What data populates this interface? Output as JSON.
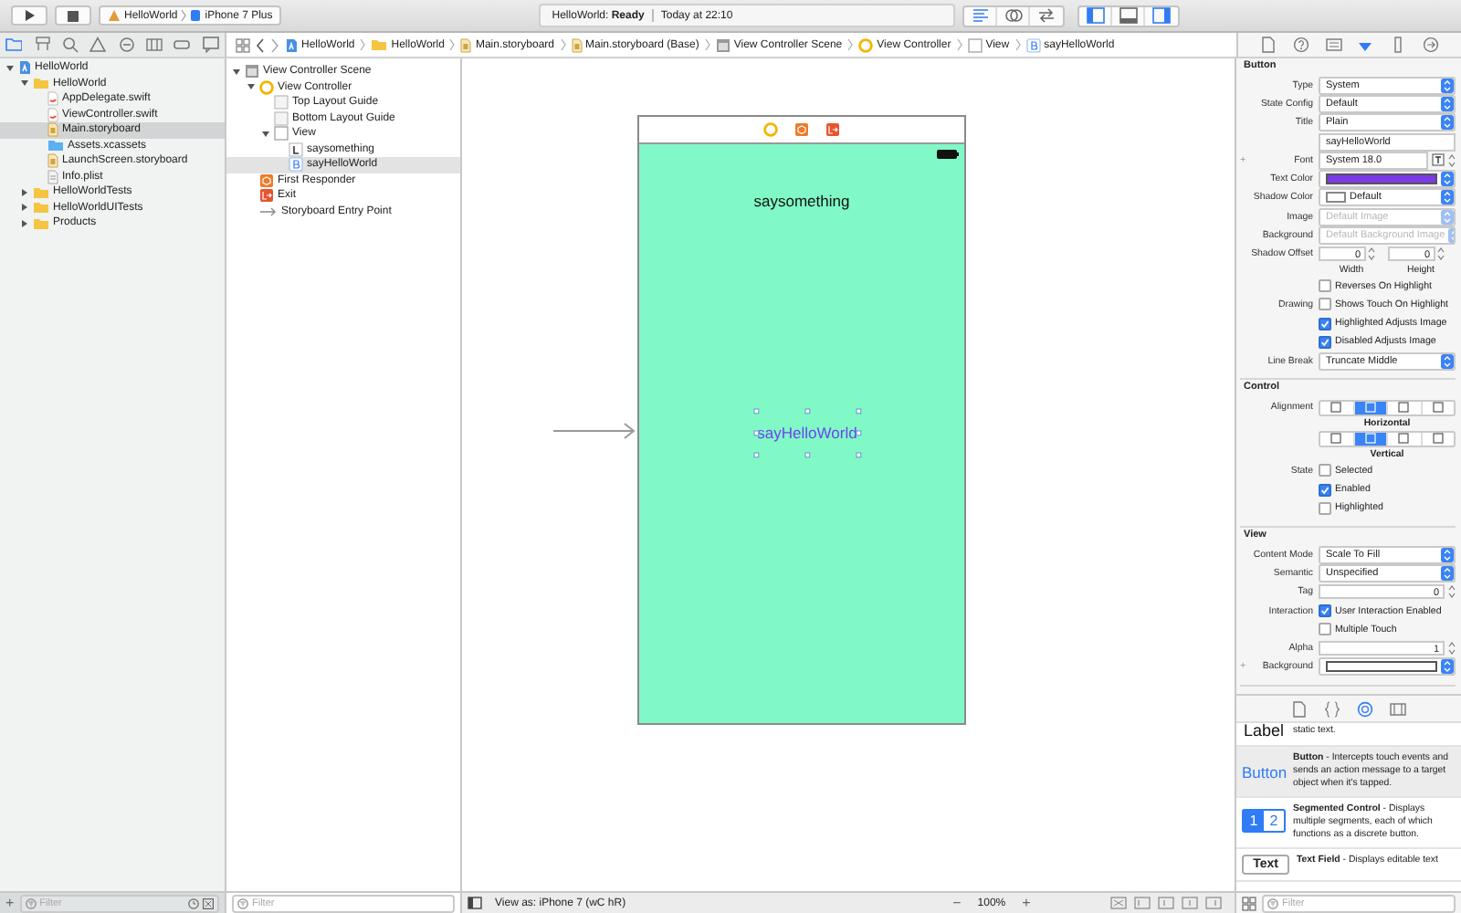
{
  "toolbar": {
    "scheme": {
      "project": "HelloWorld",
      "device": "iPhone 7 Plus"
    },
    "status": {
      "message": "HelloWorld: **Ready**",
      "time": "Today at 22:10"
    },
    "editor_modes": [
      {
        "selected": true
      },
      {
        "selected": false
      },
      {
        "selected": false
      }
    ],
    "panels": [
      {
        "on": true
      },
      {
        "on": false
      },
      {
        "on": true
      }
    ]
  },
  "navigator": {
    "tabs": [
      {
        "selected": true
      },
      {
        "selected": false
      },
      {
        "selected": false
      },
      {
        "selected": false
      },
      {
        "selected": false
      },
      {
        "selected": false
      },
      {
        "selected": false
      },
      {
        "selected": false
      }
    ],
    "items": [
      {
        "kind": "project",
        "label": "HelloWorld",
        "expanded": true,
        "selected": false,
        "children": [
          {
            "kind": "folder",
            "label": "HelloWorld",
            "expanded": true,
            "selected": false,
            "children": [
              {
                "kind": "swift",
                "label": "AppDelegate.swift",
                "selected": false
              },
              {
                "kind": "swift",
                "label": "ViewController.swift",
                "selected": false
              },
              {
                "kind": "storyboard",
                "label": "Main.storyboard",
                "selected": true
              },
              {
                "kind": "assets",
                "label": "Assets.xcassets",
                "selected": false
              },
              {
                "kind": "storyboard",
                "label": "LaunchScreen.storyboard",
                "selected": false
              },
              {
                "kind": "plist",
                "label": "Info.plist",
                "selected": false
              }
            ]
          },
          {
            "kind": "folder",
            "label": "HelloWorldTests",
            "expanded": false,
            "selected": false
          },
          {
            "kind": "folder",
            "label": "HelloWorldUITests",
            "expanded": false,
            "selected": false
          },
          {
            "kind": "folder",
            "label": "Products",
            "expanded": false,
            "selected": false
          }
        ]
      }
    ],
    "add": "+",
    "filter": {
      "placeholder": "Filter"
    }
  },
  "breadcrumb": [
    {
      "kind": "project",
      "label": "HelloWorld"
    },
    {
      "kind": "folder",
      "label": "HelloWorld"
    },
    {
      "kind": "storyboard",
      "label": "Main.storyboard"
    },
    {
      "kind": "storyboard",
      "label": "Main.storyboard (Base)"
    },
    {
      "kind": "scene",
      "label": "View Controller Scene"
    },
    {
      "kind": "viewcontroller",
      "label": "View Controller"
    },
    {
      "kind": "view",
      "label": "View"
    },
    {
      "kind": "button",
      "label": "sayHelloWorld"
    }
  ],
  "outline": {
    "items": [
      {
        "kind": "scene",
        "label": "View Controller Scene",
        "expanded": true,
        "selected": false,
        "children": [
          {
            "kind": "viewcontroller",
            "label": "View Controller",
            "expanded": true,
            "selected": false,
            "children": [
              {
                "kind": "guide",
                "label": "Top Layout Guide",
                "selected": false
              },
              {
                "kind": "guide",
                "label": "Bottom Layout Guide",
                "selected": false
              },
              {
                "kind": "view",
                "label": "View",
                "expanded": true,
                "selected": false,
                "children": [
                  {
                    "kind": "label",
                    "label": "saysomething",
                    "selected": false
                  },
                  {
                    "kind": "button",
                    "label": "sayHelloWorld",
                    "selected": true
                  }
                ]
              }
            ]
          },
          {
            "kind": "responder",
            "label": "First Responder",
            "selected": false
          },
          {
            "kind": "exit",
            "label": "Exit",
            "selected": false
          },
          {
            "kind": "entry",
            "label": "Storyboard Entry Point",
            "selected": false
          }
        ]
      }
    ],
    "filter": {
      "placeholder": "Filter"
    }
  },
  "canvas": {
    "scene": {
      "label": "saysomething",
      "button": "sayHelloWorld",
      "button_selected": true
    },
    "view_as": "View as: iPhone 7 (wC hR)",
    "zoom_out": "−",
    "zoom": "100%",
    "zoom_in": "+"
  },
  "inspector": {
    "tabs": [
      {
        "selected": false
      },
      {
        "selected": false
      },
      {
        "selected": false
      },
      {
        "selected": true
      },
      {
        "selected": false
      },
      {
        "selected": false
      }
    ],
    "sections": [
      {
        "title": "Button",
        "rows": [
          {
            "kind": "select",
            "label": "Type",
            "value": "System"
          },
          {
            "kind": "select",
            "label": "State Config",
            "value": "Default"
          },
          {
            "kind": "select",
            "label": "Title",
            "value": "Plain"
          },
          {
            "kind": "text",
            "value": "sayHelloWorld"
          },
          {
            "kind": "font",
            "prefix": "+",
            "label": "Font",
            "value": "System 18.0"
          },
          {
            "kind": "color",
            "label": "Text Color",
            "color": "#7a3be6"
          },
          {
            "kind": "select",
            "label": "Shadow Color",
            "value": "Default",
            "color": "#ffffff"
          },
          {
            "kind": "select",
            "label": "Image",
            "placeholder": "Default Image",
            "disabled": true
          },
          {
            "kind": "select",
            "label": "Background",
            "placeholder": "Default Background Image",
            "disabled": true
          },
          {
            "kind": "pair",
            "label": "Shadow Offset",
            "values": [
              "0",
              "0"
            ]
          },
          {
            "kind": "captions",
            "captions": [
              "Width",
              "Height"
            ]
          },
          {
            "kind": "check",
            "text": "Reverses On Highlight",
            "checked": false
          },
          {
            "kind": "check",
            "label": "Drawing",
            "text": "Shows Touch On Highlight",
            "checked": false
          },
          {
            "kind": "check",
            "text": "Highlighted Adjusts Image",
            "checked": true
          },
          {
            "kind": "check",
            "text": "Disabled Adjusts Image",
            "checked": true
          },
          {
            "kind": "select",
            "label": "Line Break",
            "value": "Truncate Middle"
          }
        ]
      },
      {
        "title": "Control",
        "rows": [
          {
            "kind": "segmented",
            "label": "Alignment",
            "segments": [
              {
                "selected": false
              },
              {
                "selected": true
              },
              {
                "selected": false
              },
              {
                "selected": false
              }
            ]
          },
          {
            "kind": "caption",
            "text": "Horizontal"
          },
          {
            "kind": "segmented",
            "segments": [
              {
                "selected": false
              },
              {
                "selected": true
              },
              {
                "selected": false
              },
              {
                "selected": false
              }
            ]
          },
          {
            "kind": "caption",
            "text": "Vertical"
          },
          {
            "kind": "check",
            "label": "State",
            "text": "Selected",
            "checked": false
          },
          {
            "kind": "check",
            "text": "Enabled",
            "checked": true
          },
          {
            "kind": "check",
            "text": "Highlighted",
            "checked": false
          }
        ]
      },
      {
        "title": "View",
        "rows": [
          {
            "kind": "select",
            "label": "Content Mode",
            "value": "Scale To Fill"
          },
          {
            "kind": "select",
            "label": "Semantic",
            "value": "Unspecified"
          },
          {
            "kind": "stepper",
            "label": "Tag",
            "value": "0"
          },
          {
            "kind": "check",
            "label": "Interaction",
            "text": "User Interaction Enabled",
            "checked": true
          },
          {
            "kind": "check",
            "text": "Multiple Touch",
            "checked": false
          },
          {
            "kind": "stepper",
            "label": "Alpha",
            "value": "1"
          },
          {
            "kind": "color",
            "prefix": "+",
            "label": "Background",
            "color": "#ffffff"
          }
        ]
      }
    ]
  },
  "library": {
    "tabs": [
      {
        "selected": false
      },
      {
        "selected": false
      },
      {
        "selected": true
      },
      {
        "selected": false
      }
    ],
    "items": [
      {
        "kind": "label",
        "icon": "Label",
        "text": "static text.",
        "selected": false
      },
      {
        "kind": "button",
        "icon": "Button",
        "text": "**Button** - Intercepts touch events and sends an action message to a target object when it's tapped.",
        "selected": true
      },
      {
        "kind": "segmented",
        "icon": [
          "1",
          "2"
        ],
        "text": "**Segmented Control** - Displays multiple segments, each of which functions as a discrete button.",
        "selected": false
      },
      {
        "kind": "textfield",
        "icon": "Text",
        "text": "**Text Field** - Displays editable text",
        "selected": false
      }
    ],
    "filter": {
      "placeholder": "Filter"
    }
  }
}
